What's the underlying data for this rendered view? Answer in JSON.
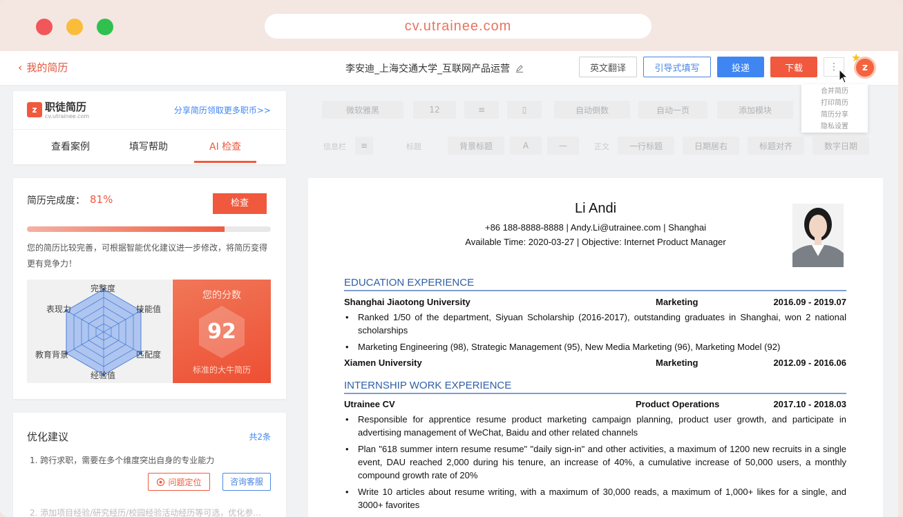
{
  "browser": {
    "url": "cv.utrainee.com",
    "dot_colors": [
      "#f0565a",
      "#f9bd3a",
      "#2fc04f"
    ]
  },
  "header": {
    "back_label": "我的简历",
    "doc_title": "李安迪_上海交通大学_互联网产品运营",
    "translate_label": "英文翻译",
    "guided_label": "引导式填写",
    "deliver_label": "投递",
    "download_label": "下载",
    "more_label": "⋮",
    "logo_letter": "z",
    "menu_items": [
      "合并简历",
      "打印简历",
      "简历分享",
      "隐私设置"
    ]
  },
  "sidebar": {
    "brand_name": "职徒简历",
    "brand_sub": "cv.utrainee.com",
    "share_link": "分享简历领取更多职币>>",
    "tabs": [
      {
        "label": "查看案例",
        "active": false
      },
      {
        "label": "填写帮助",
        "active": false
      },
      {
        "label": "AI 检查",
        "active": true
      }
    ]
  },
  "check": {
    "label": "简历完成度：",
    "percent_text": "81%",
    "progress": 0.81,
    "button_label": "检查",
    "description": "您的简历比较完善，可根据智能优化建议进一步修改，将简历变得更有竞争力！",
    "radar_labels": [
      "完整度",
      "技能值",
      "匹配度",
      "经验值",
      "教育背景",
      "表现力"
    ],
    "score_title": "您的分数",
    "score": "92",
    "score_foot": "标准的大牛简历"
  },
  "suggestions": {
    "title": "优化建议",
    "count_text": "共2条",
    "item1": "1. 跨行求职，需要在多个维度突出自身的专业能力",
    "locate_label": "问题定位",
    "service_label": "咨询客服",
    "item2": "2. 添加项目经验/研究经历/校园经验活动经历等可选，优化参..."
  },
  "toolbar": {
    "font": "微软雅黑",
    "size": "12",
    "auto_spacing": "自动倒数",
    "auto_page": "自动一页",
    "add_module": "添加模块",
    "info_label": "信息栏",
    "title_label": "标题",
    "bg_title": "背景标题",
    "body_label": "正文",
    "one_line_title": "一行标题",
    "date_right": "日期居右",
    "title_align": "标题对齐",
    "digit_date": "数字日期"
  },
  "resume": {
    "name": "Li Andi",
    "contact": "+86 188-8888-8888  |  Andy.Li@utrainee.com  |  Shanghai",
    "availability": "Available Time: 2020-03-27  |  Objective: Internet Product Manager",
    "edu_heading": "EDUCATION EXPERIENCE",
    "edu": [
      {
        "school": "Shanghai Jiaotong University",
        "major": "Marketing",
        "dates": "2016.09 - 2019.07",
        "bullets": [
          "Ranked 1/50 of the department, Siyuan Scholarship (2016-2017), outstanding graduates in Shanghai, won 2 national scholarships",
          "Marketing Engineering (98), Strategic Management (95), New Media Marketing (96), Marketing Model (92)"
        ]
      },
      {
        "school": "Xiamen University",
        "major": "Marketing",
        "dates": "2012.09 - 2016.06"
      }
    ],
    "intern_heading": "INTERNSHIP WORK EXPERIENCE",
    "intern": {
      "company": "Utrainee CV",
      "role": "Product Operations",
      "dates": "2017.10 - 2018.03",
      "bullets": [
        "Responsible for apprentice resume product marketing campaign planning, product user growth, and participate in advertising management of WeChat, Baidu and other related channels",
        "Plan \"618 summer intern resume resume\" \"daily sign-in\" and other activities, a maximum of 1200 new recruits in a single event, DAU reached 2,000 during his tenure, an increase of 40%, a cumulative increase of 50,000 users, a monthly compound growth rate of 20%",
        "Write 10 articles about resume writing, with a maximum of 30,000 reads, a maximum of 1,000+ likes for a single, and 3000+ favorites"
      ]
    }
  }
}
